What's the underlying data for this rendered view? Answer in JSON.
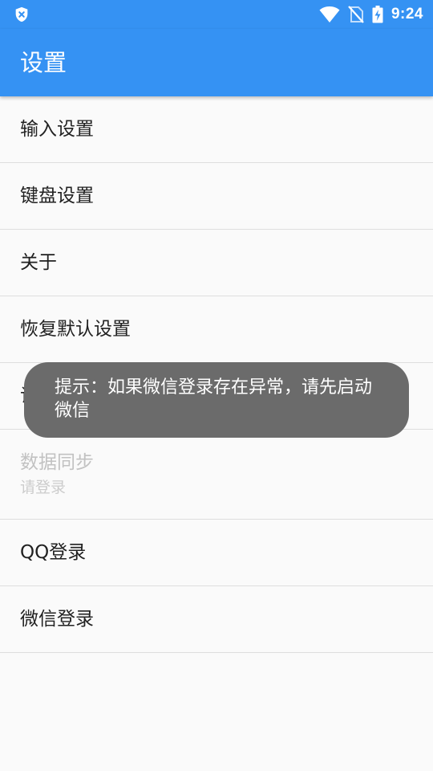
{
  "status_bar": {
    "time": "9:24",
    "left_icon": "shield-x-icon",
    "icons": [
      "wifi-icon",
      "no-sim-icon",
      "battery-charging-icon"
    ]
  },
  "app_bar": {
    "title": "设置"
  },
  "settings": {
    "items": [
      {
        "label": "输入设置"
      },
      {
        "label": "键盘设置"
      },
      {
        "label": "关于"
      },
      {
        "label": "恢复默认设置"
      },
      {
        "label": "词库"
      },
      {
        "label": "数据同步",
        "summary": "请登录"
      },
      {
        "label": "QQ登录"
      },
      {
        "label": "微信登录"
      }
    ]
  },
  "toast": {
    "message": "提示：如果微信登录存在异常，请先启动微信"
  },
  "colors": {
    "primary": "#3592f3",
    "background": "#fafafa",
    "divider": "#dedede",
    "toast_background": "#6b6b6b"
  }
}
